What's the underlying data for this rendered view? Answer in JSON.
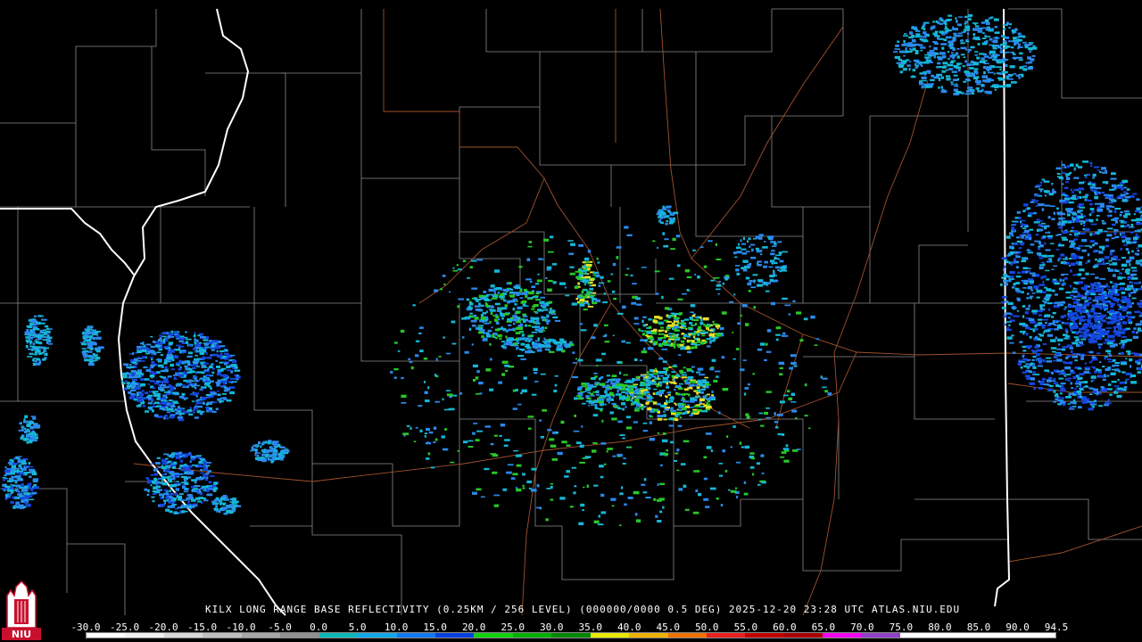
{
  "caption": {
    "text": "KILX LONG RANGE BASE REFLECTIVITY (0.25KM / 256 LEVEL) (000000/0000 0.5 DEG) 2025-12-20 23:28 UTC  ATLAS.NIU.EDU"
  },
  "logo": {
    "text": "NIU",
    "color": "#c8102e"
  },
  "scale": {
    "labels": [
      "-30.0",
      "-25.0",
      "-20.0",
      "-15.0",
      "-10.0",
      "-5.0",
      "0.0",
      "5.0",
      "10.0",
      "15.0",
      "20.0",
      "25.0",
      "30.0",
      "35.0",
      "40.0",
      "45.0",
      "50.0",
      "55.0",
      "60.0",
      "65.0",
      "70.0",
      "75.0",
      "80.0",
      "85.0",
      "90.0",
      "94.5"
    ],
    "colors": [
      "#ffffff",
      "#f0f0f0",
      "#d8d8d8",
      "#c0c0c0",
      "#a8a8a8",
      "#909090",
      "#08b8b8",
      "#10a8e8",
      "#1078f0",
      "#0040e0",
      "#10d010",
      "#00b000",
      "#008800",
      "#e8e800",
      "#f0b000",
      "#f07000",
      "#e82020",
      "#c00000",
      "#a80000",
      "#f000f0",
      "#9040c8",
      "#ffffff",
      "#ffffff",
      "#ffffff",
      "#ffffff"
    ]
  },
  "map": {
    "colors": {
      "county_line": "#8a8a8a",
      "state_line": "#ffffff",
      "highway": "#a0522d",
      "echo_light": "#14b8d8",
      "echo_medium": "#2a8aee",
      "echo_strong": "#1446e0",
      "echo_green": "#28c828",
      "echo_yellow": "#e8e028"
    }
  }
}
